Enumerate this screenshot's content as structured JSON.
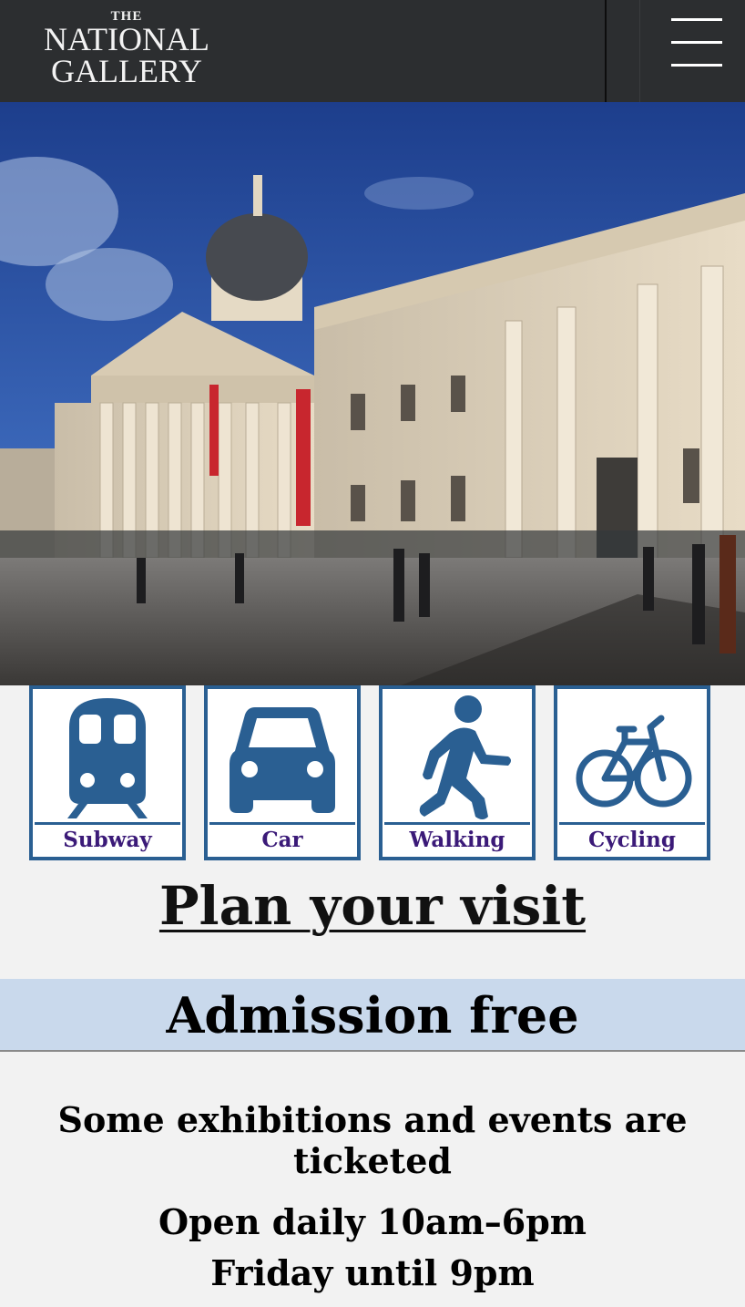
{
  "header": {
    "logo": {
      "line1": "THE",
      "line2": "NATIONAL",
      "line3": "GALLERY"
    },
    "menu_icon": "hamburger-menu-icon",
    "background_color": "#2c2e30"
  },
  "hero": {
    "image_alt": "The National Gallery building, Trafalgar Square"
  },
  "transport": [
    {
      "label": "Subway",
      "icon": "train-icon"
    },
    {
      "label": "Car",
      "icon": "car-icon"
    },
    {
      "label": "Walking",
      "icon": "walking-icon"
    },
    {
      "label": "Cycling",
      "icon": "bicycle-icon"
    }
  ],
  "transport_colors": {
    "border": "#2a5f92",
    "icon": "#2a5f92",
    "label": "#3b1a78"
  },
  "plan_link": "Plan your visit",
  "admission": {
    "title": "Admission free",
    "background": "#c9d9ec"
  },
  "info": {
    "ticketed": "Some exhibitions and events are ticketed",
    "hours": "Open daily 10am–6pm",
    "friday": "Friday until 9pm"
  }
}
